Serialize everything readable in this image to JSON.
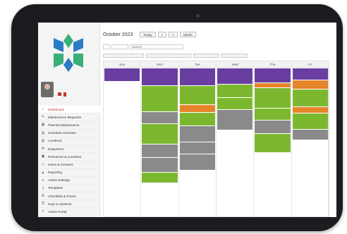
{
  "calendar": {
    "month_title": "October 2023",
    "buttons": [
      "Today",
      "<",
      ">",
      "Month"
    ],
    "filters": {
      "search_placeholder": "Search",
      "input1": "",
      "input2": ""
    },
    "checkboxes": [
      "",
      "",
      "",
      ""
    ],
    "days": [
      "Sun",
      "Mon",
      "Tue",
      "Wed",
      "Thu",
      "Fri"
    ],
    "columns": [
      {
        "events": [
          {
            "color": "purple",
            "h": 18
          }
        ]
      },
      {
        "events": [
          {
            "color": "purple",
            "h": 24
          },
          {
            "color": "green",
            "h": 36
          },
          {
            "color": "gray",
            "h": 16
          },
          {
            "color": "green",
            "h": 28
          },
          {
            "color": "gray",
            "h": 18
          },
          {
            "color": "gray",
            "h": 20
          },
          {
            "color": "green",
            "h": 14
          }
        ]
      },
      {
        "events": [
          {
            "color": "purple",
            "h": 24
          },
          {
            "color": "green",
            "h": 26
          },
          {
            "color": "orange",
            "h": 10
          },
          {
            "color": "green",
            "h": 18
          },
          {
            "color": "gray",
            "h": 22
          },
          {
            "color": "gray",
            "h": 16
          },
          {
            "color": "gray",
            "h": 22
          }
        ]
      },
      {
        "events": [
          {
            "color": "purple",
            "h": 22
          },
          {
            "color": "green",
            "h": 18
          },
          {
            "color": "green",
            "h": 16
          },
          {
            "color": "gray",
            "h": 28
          }
        ]
      },
      {
        "events": [
          {
            "color": "purple",
            "h": 20
          },
          {
            "color": "orange",
            "h": 6
          },
          {
            "color": "green",
            "h": 28
          },
          {
            "color": "green",
            "h": 16
          },
          {
            "color": "gray",
            "h": 18
          },
          {
            "color": "green",
            "h": 26
          }
        ]
      },
      {
        "events": [
          {
            "color": "purple",
            "h": 16
          },
          {
            "color": "orange",
            "h": 12
          },
          {
            "color": "green",
            "h": 24
          },
          {
            "color": "orange",
            "h": 8
          },
          {
            "color": "green",
            "h": 22
          },
          {
            "color": "gray",
            "h": 14
          }
        ]
      }
    ]
  },
  "sidebar": {
    "user": {
      "name": "",
      "role": "",
      "badge": ""
    },
    "items": [
      {
        "icon": "home",
        "label": "Dashboard",
        "active": true
      },
      {
        "icon": "wrench",
        "label": "Maintenance Requests"
      },
      {
        "icon": "calendar",
        "label": "Planned Maintenance"
      },
      {
        "icon": "clipboard",
        "label": "Schedule Overview"
      },
      {
        "icon": "building",
        "label": "Locations"
      },
      {
        "icon": "gear",
        "label": "Equipment"
      },
      {
        "icon": "box",
        "label": "Resources & Locations"
      },
      {
        "icon": "people",
        "label": "Users & Contacts"
      },
      {
        "icon": "chart",
        "label": "Reporting"
      },
      {
        "icon": "sliders",
        "label": "Admin Settings"
      },
      {
        "icon": "doc",
        "label": "Templates"
      },
      {
        "icon": "list",
        "label": "Checklists & Forms"
      },
      {
        "icon": "key",
        "label": "Keys & Systems"
      },
      {
        "icon": "help",
        "label": "Admin Portal"
      },
      {
        "icon": "info",
        "label": ""
      }
    ]
  },
  "colors": {
    "purple": "#6a3ea1",
    "green": "#7cb82f",
    "orange": "#e6842a",
    "gray": "#8a8a8a",
    "accent": "#c0392b"
  }
}
